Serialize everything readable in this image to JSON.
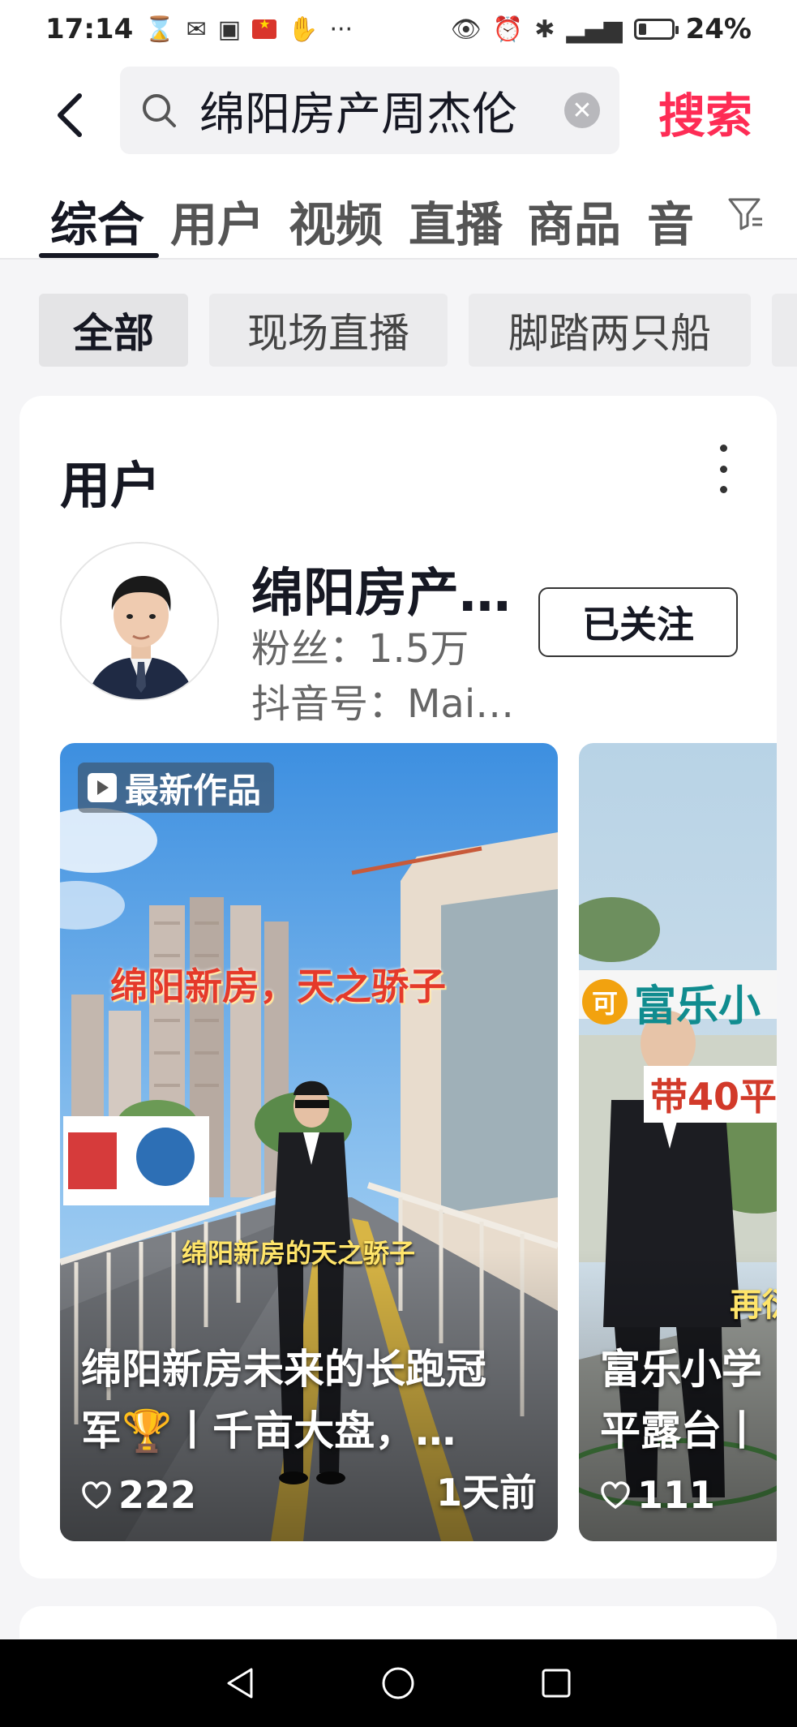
{
  "status_bar": {
    "time": "17:14",
    "battery_text": "24%",
    "battery_level": 0.24
  },
  "search": {
    "query": "绵阳房产周杰伦",
    "button_label": "搜索"
  },
  "tabs": [
    {
      "label": "综合",
      "active": true
    },
    {
      "label": "用户"
    },
    {
      "label": "视频"
    },
    {
      "label": "直播"
    },
    {
      "label": "商品"
    },
    {
      "label": "音"
    }
  ],
  "chips": [
    {
      "label": "全部",
      "active": true
    },
    {
      "label": "现场直播"
    },
    {
      "label": "脚踏两只船"
    }
  ],
  "user_section": {
    "title": "用户",
    "user": {
      "name": "绵阳房产…",
      "fans": "粉丝：1.5万",
      "douyin_id": "抖音号：Mai…",
      "follow_label": "已关注"
    }
  },
  "videos": [
    {
      "badge": "最新作品",
      "overlay_headline": "绵阳新房，天之骄子",
      "overlay_caption": "绵阳新房的天之骄子",
      "title_line1": "绵阳新房未来的长跑冠",
      "title_line2": "军🏆丨千亩大盘，…",
      "likes": "222",
      "time": "1天前"
    },
    {
      "overlay_tag": "富乐小",
      "overlay_tag_prefix": "可",
      "overlay_sub": "带40平",
      "overlay_side": "再衍",
      "title_line1": "富乐小学",
      "title_line2": "平露台丨",
      "likes": "111"
    }
  ],
  "colors": {
    "accent": "#fe2c55",
    "text_primary": "#161823",
    "background": "#f5f5f7"
  }
}
